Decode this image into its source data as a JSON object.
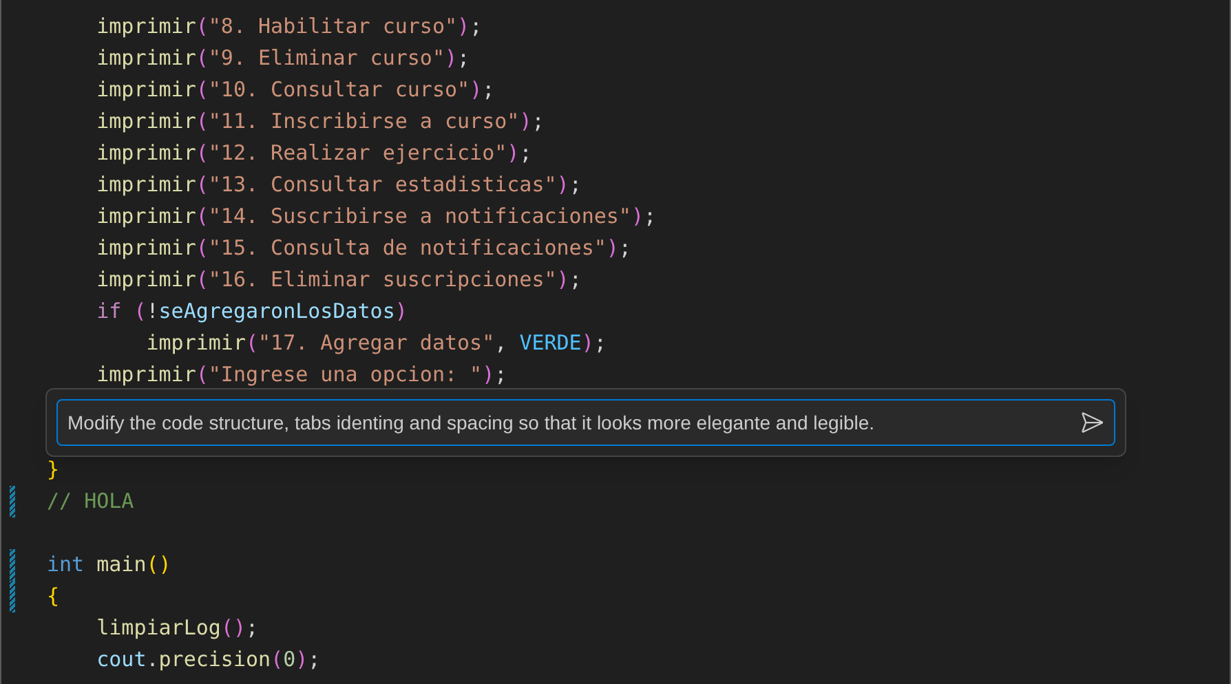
{
  "editor": {
    "lines": [
      {
        "modified": false,
        "tokens": [
          {
            "kind": "fn",
            "text": "    imprimir"
          },
          {
            "kind": "b1",
            "text": "("
          },
          {
            "kind": "str",
            "text": "\"8. Habilitar curso\""
          },
          {
            "kind": "b1",
            "text": ")"
          },
          {
            "kind": "punct",
            "text": ";"
          }
        ]
      },
      {
        "modified": false,
        "tokens": [
          {
            "kind": "fn",
            "text": "    imprimir"
          },
          {
            "kind": "b1",
            "text": "("
          },
          {
            "kind": "str",
            "text": "\"9. Eliminar curso\""
          },
          {
            "kind": "b1",
            "text": ")"
          },
          {
            "kind": "punct",
            "text": ";"
          }
        ]
      },
      {
        "modified": false,
        "tokens": [
          {
            "kind": "fn",
            "text": "    imprimir"
          },
          {
            "kind": "b1",
            "text": "("
          },
          {
            "kind": "str",
            "text": "\"10. Consultar curso\""
          },
          {
            "kind": "b1",
            "text": ")"
          },
          {
            "kind": "punct",
            "text": ";"
          }
        ]
      },
      {
        "modified": false,
        "tokens": [
          {
            "kind": "fn",
            "text": "    imprimir"
          },
          {
            "kind": "b1",
            "text": "("
          },
          {
            "kind": "str",
            "text": "\"11. Inscribirse a curso\""
          },
          {
            "kind": "b1",
            "text": ")"
          },
          {
            "kind": "punct",
            "text": ";"
          }
        ]
      },
      {
        "modified": false,
        "tokens": [
          {
            "kind": "fn",
            "text": "    imprimir"
          },
          {
            "kind": "b1",
            "text": "("
          },
          {
            "kind": "str",
            "text": "\"12. Realizar ejercicio\""
          },
          {
            "kind": "b1",
            "text": ")"
          },
          {
            "kind": "punct",
            "text": ";"
          }
        ]
      },
      {
        "modified": false,
        "tokens": [
          {
            "kind": "fn",
            "text": "    imprimir"
          },
          {
            "kind": "b1",
            "text": "("
          },
          {
            "kind": "str",
            "text": "\"13. Consultar estadisticas\""
          },
          {
            "kind": "b1",
            "text": ")"
          },
          {
            "kind": "punct",
            "text": ";"
          }
        ]
      },
      {
        "modified": false,
        "tokens": [
          {
            "kind": "fn",
            "text": "    imprimir"
          },
          {
            "kind": "b1",
            "text": "("
          },
          {
            "kind": "str",
            "text": "\"14. Suscribirse a notificaciones\""
          },
          {
            "kind": "b1",
            "text": ")"
          },
          {
            "kind": "punct",
            "text": ";"
          }
        ]
      },
      {
        "modified": false,
        "tokens": [
          {
            "kind": "fn",
            "text": "    imprimir"
          },
          {
            "kind": "b1",
            "text": "("
          },
          {
            "kind": "str",
            "text": "\"15. Consulta de notificaciones\""
          },
          {
            "kind": "b1",
            "text": ")"
          },
          {
            "kind": "punct",
            "text": ";"
          }
        ]
      },
      {
        "modified": false,
        "tokens": [
          {
            "kind": "fn",
            "text": "    imprimir"
          },
          {
            "kind": "b1",
            "text": "("
          },
          {
            "kind": "str",
            "text": "\"16. Eliminar suscripciones\""
          },
          {
            "kind": "b1",
            "text": ")"
          },
          {
            "kind": "punct",
            "text": ";"
          }
        ]
      },
      {
        "modified": false,
        "tokens": [
          {
            "kind": "kw",
            "text": "    if "
          },
          {
            "kind": "b1",
            "text": "("
          },
          {
            "kind": "punct",
            "text": "!"
          },
          {
            "kind": "var",
            "text": "seAgregaronLosDatos"
          },
          {
            "kind": "b1",
            "text": ")"
          }
        ]
      },
      {
        "modified": false,
        "tokens": [
          {
            "kind": "fn",
            "text": "        imprimir"
          },
          {
            "kind": "b1",
            "text": "("
          },
          {
            "kind": "str",
            "text": "\"17. Agregar datos\""
          },
          {
            "kind": "punct",
            "text": ", "
          },
          {
            "kind": "const",
            "text": "VERDE"
          },
          {
            "kind": "b1",
            "text": ")"
          },
          {
            "kind": "punct",
            "text": ";"
          }
        ]
      },
      {
        "modified": false,
        "tokens": [
          {
            "kind": "fn",
            "text": "    imprimir"
          },
          {
            "kind": "b1",
            "text": "("
          },
          {
            "kind": "str",
            "text": "\"Ingrese una opcion: \""
          },
          {
            "kind": "b1",
            "text": ")"
          },
          {
            "kind": "punct",
            "text": ";"
          }
        ]
      },
      {
        "modified": false
      },
      {
        "modified": false
      },
      {
        "modified": false,
        "tokens": [
          {
            "kind": "b0",
            "text": "}"
          }
        ]
      },
      {
        "modified": true,
        "tokens": [
          {
            "kind": "comment",
            "text": "// HOLA"
          }
        ]
      },
      {
        "modified": false
      },
      {
        "modified": true,
        "tokens": [
          {
            "kind": "type",
            "text": "int "
          },
          {
            "kind": "fn",
            "text": "main"
          },
          {
            "kind": "b0",
            "text": "()"
          }
        ]
      },
      {
        "modified": true,
        "tokens": [
          {
            "kind": "b0",
            "text": "{"
          }
        ]
      },
      {
        "modified": false,
        "tokens": [
          {
            "kind": "fn",
            "text": "    limpiarLog"
          },
          {
            "kind": "b1",
            "text": "()"
          },
          {
            "kind": "punct",
            "text": ";"
          }
        ]
      },
      {
        "modified": false,
        "tokens": [
          {
            "kind": "var",
            "text": "    cout"
          },
          {
            "kind": "punct",
            "text": "."
          },
          {
            "kind": "fn",
            "text": "precision"
          },
          {
            "kind": "b1",
            "text": "("
          },
          {
            "kind": "num",
            "text": "0"
          },
          {
            "kind": "b1",
            "text": ")"
          },
          {
            "kind": "punct",
            "text": ";"
          }
        ]
      }
    ]
  },
  "chat": {
    "value": "Modify the code structure, tabs identing and spacing so that it looks more elegante and legible."
  }
}
